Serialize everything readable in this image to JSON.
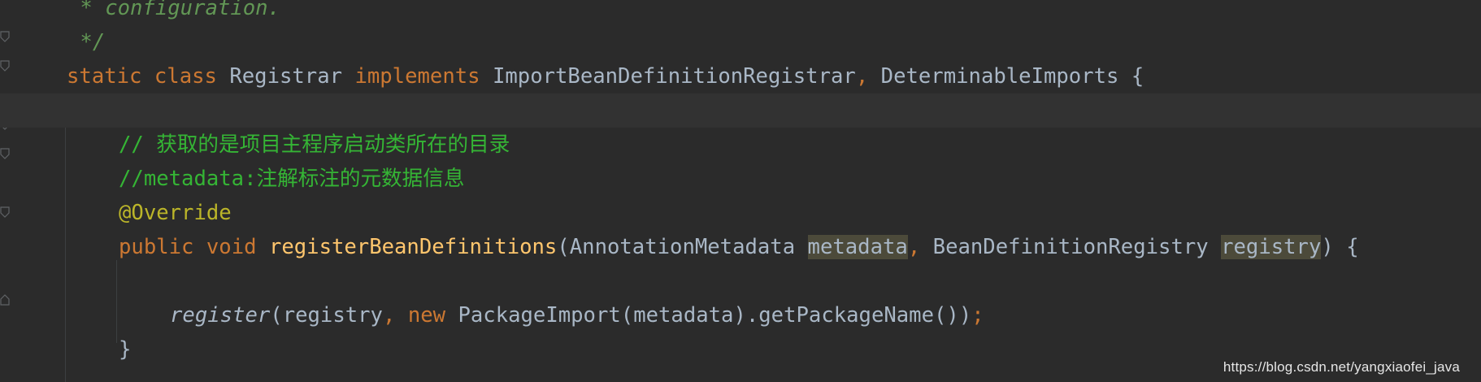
{
  "editor": {
    "lines": {
      "l1": {
        "doc": " * configuration."
      },
      "l2": {
        "doc": " */"
      },
      "l3": {
        "kw_static": "static",
        "kw_class": "class",
        "cls_name": "Registrar",
        "kw_implements": "implements",
        "iface1": "ImportBeanDefinitionRegistrar",
        "comma": ",",
        "iface2": "DeterminableImports",
        "brace": "{"
      },
      "l4": {},
      "l5": {
        "comment": "// 获取的是项目主程序启动类所在的目录"
      },
      "l6": {
        "comment": "//metadata:注解标注的元数据信息"
      },
      "l7": {
        "annotation": "@Override"
      },
      "l8": {
        "kw_public": "public",
        "kw_void": "void",
        "method": "registerBeanDefinitions",
        "open": "(",
        "type1": "AnnotationMetadata",
        "param1": "metadata",
        "comma": ",",
        "type2": "BeanDefinitionRegistry",
        "param2": "registry",
        "close": ") {"
      },
      "l9": {},
      "l10": {
        "call": "register",
        "args_a": "(registry",
        "comma": ",",
        "kw_new": "new",
        "rest": "PackageImport(metadata).getPackageName())",
        "semi": ";"
      },
      "l11": {
        "brace": "}"
      }
    },
    "colors": {
      "background": "#2b2b2b",
      "keyword": "#cc7832",
      "method": "#ffc66d",
      "annotation": "#bbb529",
      "comment": "#35b535",
      "doc_comment": "#629755",
      "text": "#a9b7c6"
    }
  },
  "watermark": "https://blog.csdn.net/yangxiaofei_java"
}
